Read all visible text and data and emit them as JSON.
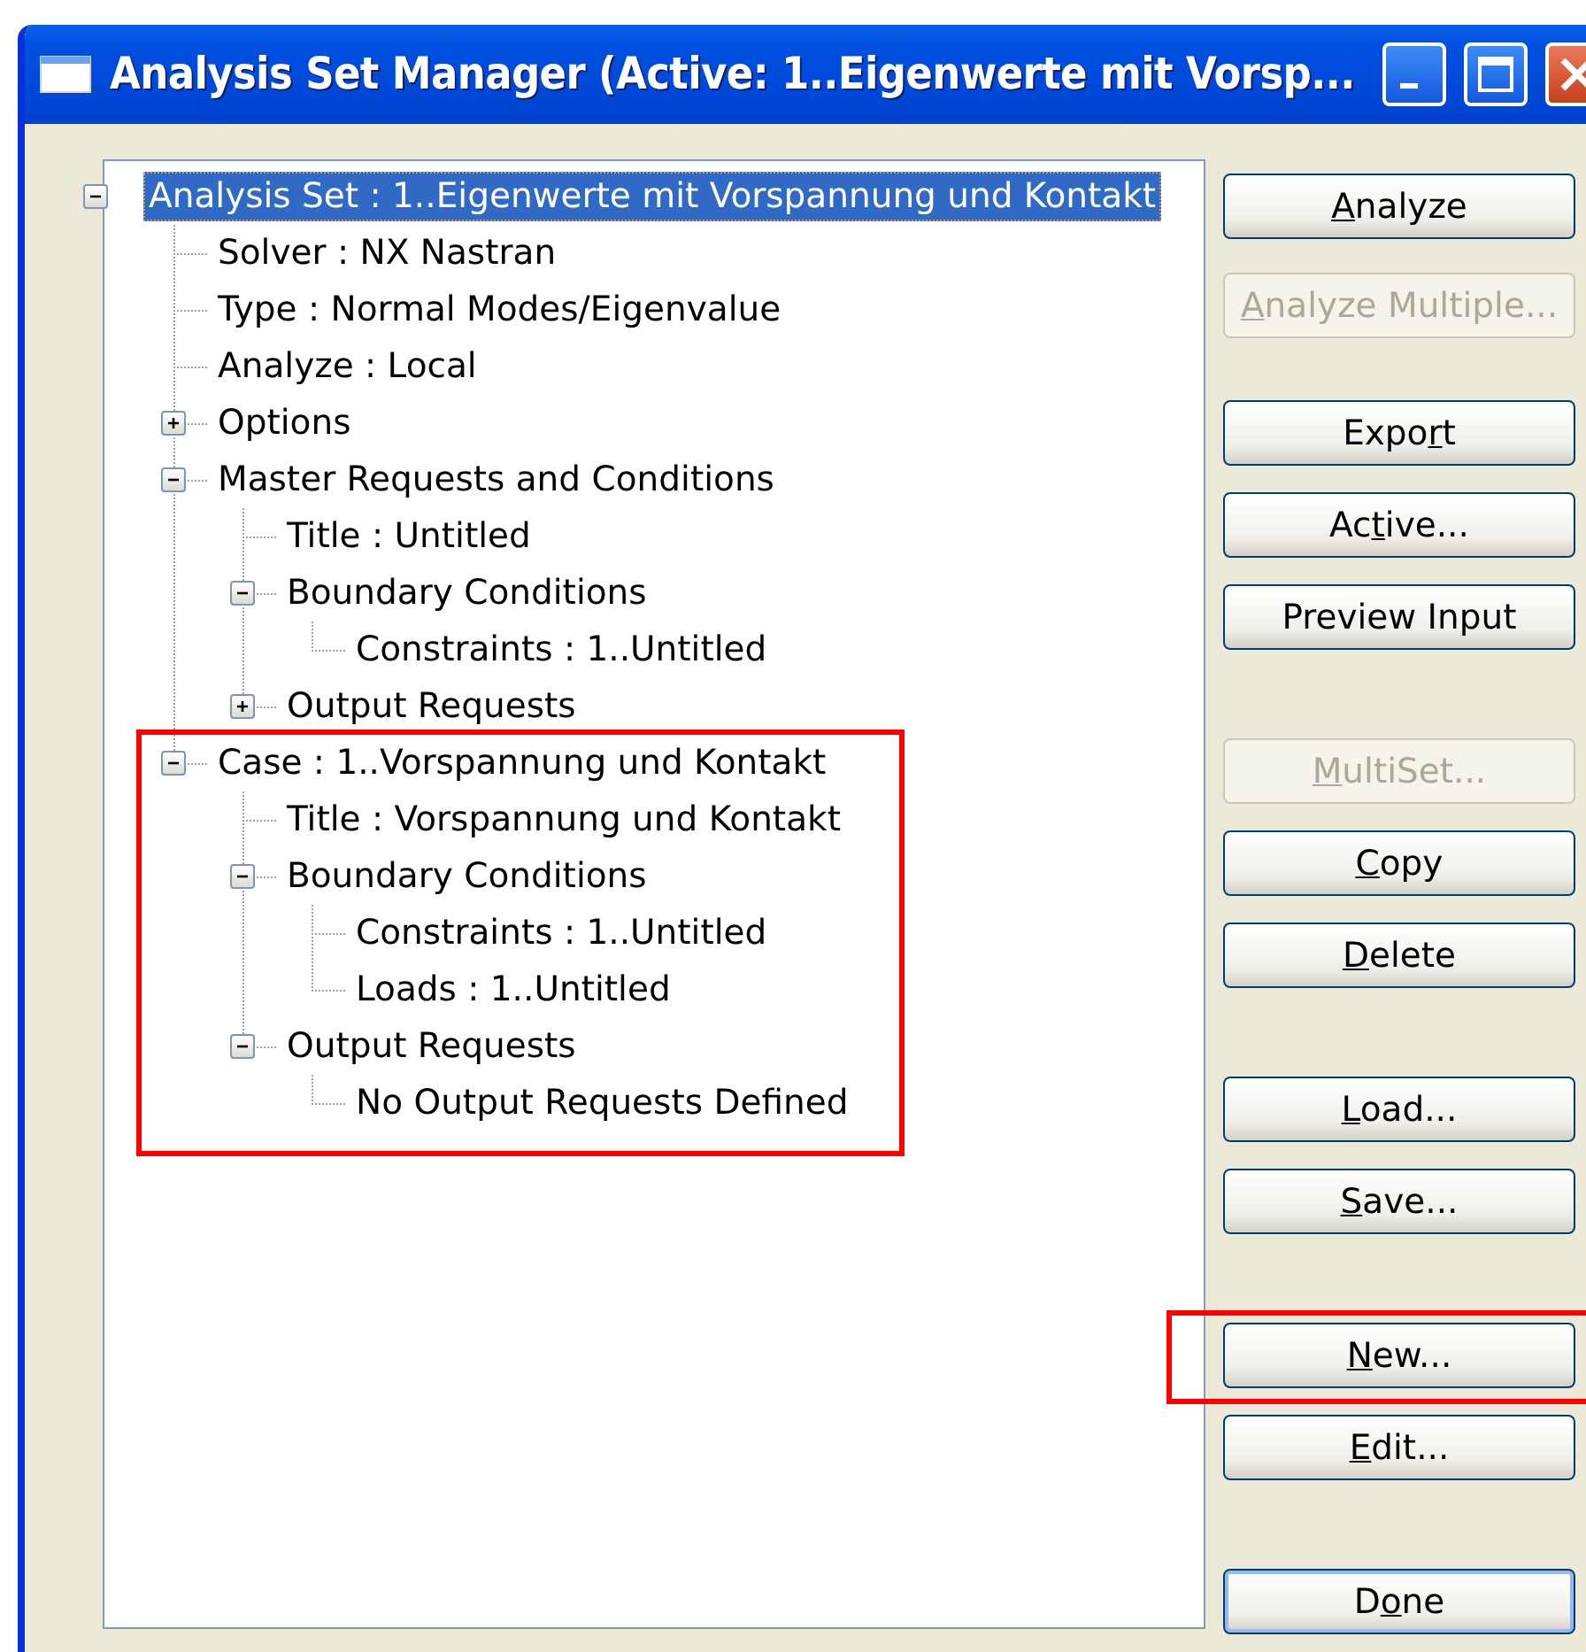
{
  "window": {
    "title": "Analysis Set Manager (Active: 1..Eigenwerte mit Vorsp..."
  },
  "tree": [
    {
      "label": "Analysis Set : 1..Eigenwerte mit Vorspannung und Kontakt",
      "selected": true,
      "expanded": true,
      "children": [
        {
          "label": "Solver : NX Nastran",
          "selected": false
        },
        {
          "label": "Type : Normal Modes/Eigenvalue",
          "selected": false
        },
        {
          "label": "Analyze : Local",
          "selected": false
        },
        {
          "label": "Options",
          "selected": false,
          "expanded": false
        },
        {
          "label": "Master Requests and Conditions",
          "selected": false,
          "expanded": true,
          "children": [
            {
              "label": "Title : Untitled",
              "selected": false
            },
            {
              "label": "Boundary Conditions",
              "selected": false,
              "expanded": true,
              "children": [
                {
                  "label": "Constraints : 1..Untitled",
                  "selected": false
                }
              ]
            },
            {
              "label": "Output Requests",
              "selected": false,
              "expanded": false
            }
          ]
        },
        {
          "label": "Case : 1..Vorspannung und Kontakt",
          "selected": false,
          "expanded": true,
          "highlighted": true,
          "children": [
            {
              "label": "Title : Vorspannung und Kontakt",
              "selected": false
            },
            {
              "label": "Boundary Conditions",
              "selected": false,
              "expanded": true,
              "children": [
                {
                  "label": "Constraints : 1..Untitled",
                  "selected": false
                },
                {
                  "label": "Loads : 1..Untitled",
                  "selected": false
                }
              ]
            },
            {
              "label": "Output Requests",
              "selected": false,
              "expanded": true,
              "children": [
                {
                  "label": "No Output Requests Defined",
                  "selected": false
                }
              ]
            }
          ]
        }
      ]
    }
  ],
  "button_groups": [
    [
      {
        "key": "A",
        "post": "nalyze",
        "disabled": false,
        "default": false
      },
      {
        "key": "A",
        "post": "nalyze Multiple...",
        "disabled": true,
        "default": false
      }
    ],
    [
      {
        "pre": "Expo",
        "key": "r",
        "post": "t",
        "disabled": false,
        "default": false
      },
      {
        "pre": "Ac",
        "key": "t",
        "post": "ive...",
        "disabled": false,
        "default": false
      },
      {
        "pre": "Preview Input",
        "disabled": false,
        "default": false
      }
    ],
    [
      {
        "key": "M",
        "post": "ultiSet...",
        "disabled": true,
        "default": false
      },
      {
        "key": "C",
        "post": "opy",
        "disabled": false,
        "default": false
      },
      {
        "key": "D",
        "post": "elete",
        "disabled": false,
        "default": false
      }
    ],
    [
      {
        "key": "L",
        "post": "oad...",
        "disabled": false,
        "default": false
      },
      {
        "key": "S",
        "post": "ave...",
        "disabled": false,
        "default": false
      }
    ],
    [
      {
        "key": "N",
        "post": "ew...",
        "disabled": false,
        "default": false,
        "highlighted": true
      },
      {
        "key": "E",
        "post": "dit...",
        "disabled": false,
        "default": false
      }
    ],
    [
      {
        "pre": "D",
        "key": "o",
        "post": "ne",
        "disabled": false,
        "default": true
      }
    ]
  ]
}
